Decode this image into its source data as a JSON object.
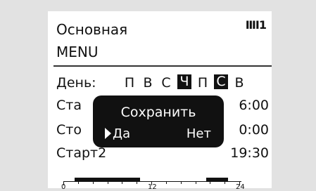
{
  "header": {
    "title": "Основная",
    "heater_indicator": "ⅢI1",
    "menu_label": "MENU"
  },
  "day_row": {
    "label": "День:",
    "days": [
      {
        "text": "П",
        "selected": false
      },
      {
        "text": "В",
        "selected": false
      },
      {
        "text": "С",
        "selected": false
      },
      {
        "text": "Ч",
        "selected": true
      },
      {
        "text": "П",
        "selected": false
      },
      {
        "text": "С",
        "selected": true
      },
      {
        "text": "В",
        "selected": false
      }
    ]
  },
  "rows": [
    {
      "label": "Ста",
      "value": "6:00"
    },
    {
      "label": "Сто",
      "value": "0:00"
    },
    {
      "label": "Старт2",
      "value": "19:30"
    }
  ],
  "dialog": {
    "title": "Сохранить",
    "yes": "Да",
    "no": "Нет",
    "selected": "yes"
  },
  "timeline": {
    "ticks": [
      "0",
      "12",
      "24"
    ],
    "active_periods": [
      [
        1.5,
        10.5
      ],
      [
        19.5,
        22.5
      ]
    ],
    "max_hour": 24
  },
  "colors": {
    "background": "#e2e2e2",
    "screen": "#ffffff",
    "ink": "#111111"
  }
}
